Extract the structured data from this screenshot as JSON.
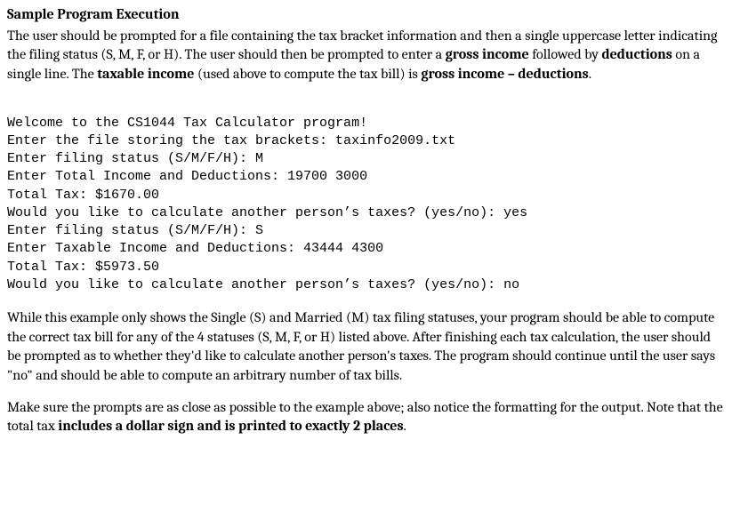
{
  "heading": "Sample Program Execution",
  "p1a": "The user should be prompted for a file containing the tax bracket information and then a single uppercase letter indicating the filing status (S, M, F, or H). The user should then be prompted to enter a ",
  "p1b": "gross income",
  "p1c": " followed by ",
  "p1d": "deductions",
  "p1e": " on a single line. The ",
  "p1f": "taxable income",
  "p1g": " (used above to compute the tax bill) is ",
  "p1h": "gross income – deductions",
  "p1i": ".",
  "code_lines": [
    "Welcome to the CS1044 Tax Calculator program!",
    "Enter the file storing the tax brackets: taxinfo2009.txt",
    "Enter filing status (S/M/F/H): M",
    "Enter Total Income and Deductions: 19700 3000",
    "Total Tax: $1670.00",
    "Would you like to calculate another person’s taxes? (yes/no): yes",
    "Enter filing status (S/M/F/H): S",
    "Enter Taxable Income and Deductions: 43444 4300",
    "Total Tax: $5973.50",
    "Would you like to calculate another person’s taxes? (yes/no): no"
  ],
  "p2": "While this example only shows the Single (S) and Married (M) tax filing statuses, your program should be able to compute the correct tax bill for any of the 4 statuses (S, M, F, or H) listed above. After finishing each tax calculation, the user should be prompted as to whether they'd like to calculate another person's taxes. The program should continue until the user says \"no\" and should be able to compute an arbitrary number of tax bills.",
  "p3a": "Make sure the prompts are as close as possible to the example above; also notice the formatting for the output. Note that the total tax ",
  "p3b": "includes a dollar sign and is printed to exactly 2 places",
  "p3c": "."
}
